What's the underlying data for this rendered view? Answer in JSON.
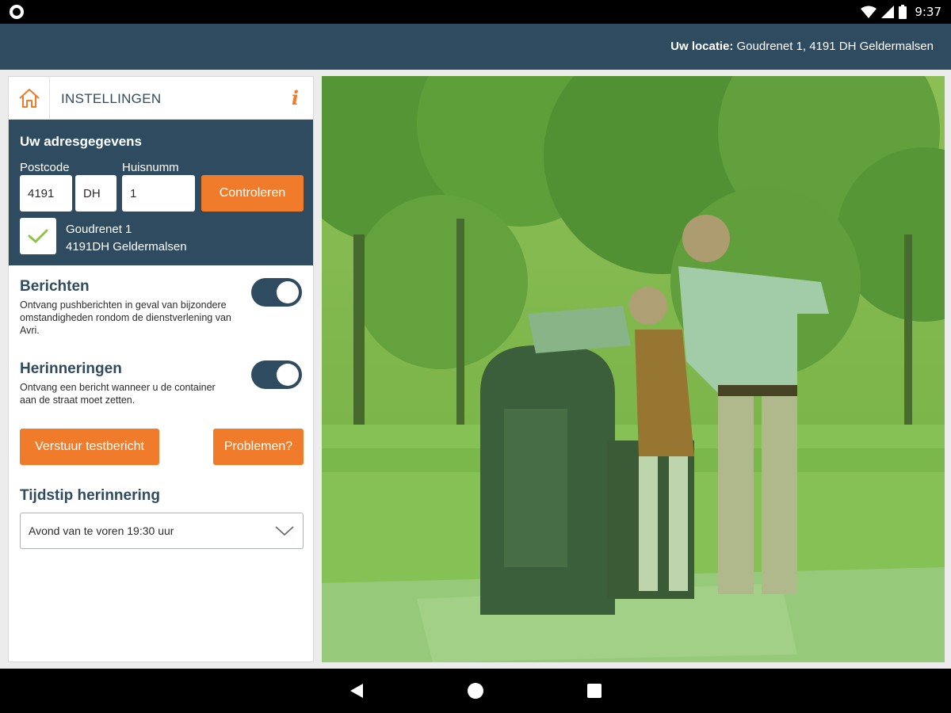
{
  "status_bar": {
    "time": "9:37",
    "icons": [
      "circle-notification-icon",
      "wifi-icon",
      "signal-icon",
      "battery-icon"
    ]
  },
  "app_bar": {
    "location_label": "Uw locatie:",
    "location_value": " Goudrenet 1, 4191 DH Geldermalsen"
  },
  "panel": {
    "home_icon": "home-icon",
    "title": "INSTELLINGEN",
    "info_icon_text": "i"
  },
  "address": {
    "title": "Uw adresgegevens",
    "postcode_label": "Postcode",
    "huisnummer_label": "Huisnumm",
    "postcode_digits": "4191",
    "postcode_letters": "DH",
    "huisnummer": "1",
    "check_button": "Controleren",
    "result_line1": "Goudrenet 1",
    "result_line2": "4191DH Geldermalsen"
  },
  "settings": {
    "berichten": {
      "title": "Berichten",
      "description": "Ontvang pushberichten in geval van bijzondere omstandigheden rondom de dienstverlening van Avri.",
      "enabled": true
    },
    "herinneringen": {
      "title": "Herinneringen",
      "description": "Ontvang een bericht wanneer u de container aan de straat moet zetten.",
      "enabled": true
    }
  },
  "buttons": {
    "test_message": "Verstuur testbericht",
    "problems": "Problemen?"
  },
  "reminder_time": {
    "title": "Tijdstip herinnering",
    "selected": "Avond van te voren 19:30 uur"
  },
  "colors": {
    "primary": "#2f4b5f",
    "accent": "#f07b2a",
    "check_green": "#8cc63f",
    "photo_overlay": "#7fbf3f"
  },
  "nav_bar": {
    "icons": [
      "back-icon",
      "home-circle-icon",
      "recents-icon"
    ]
  }
}
